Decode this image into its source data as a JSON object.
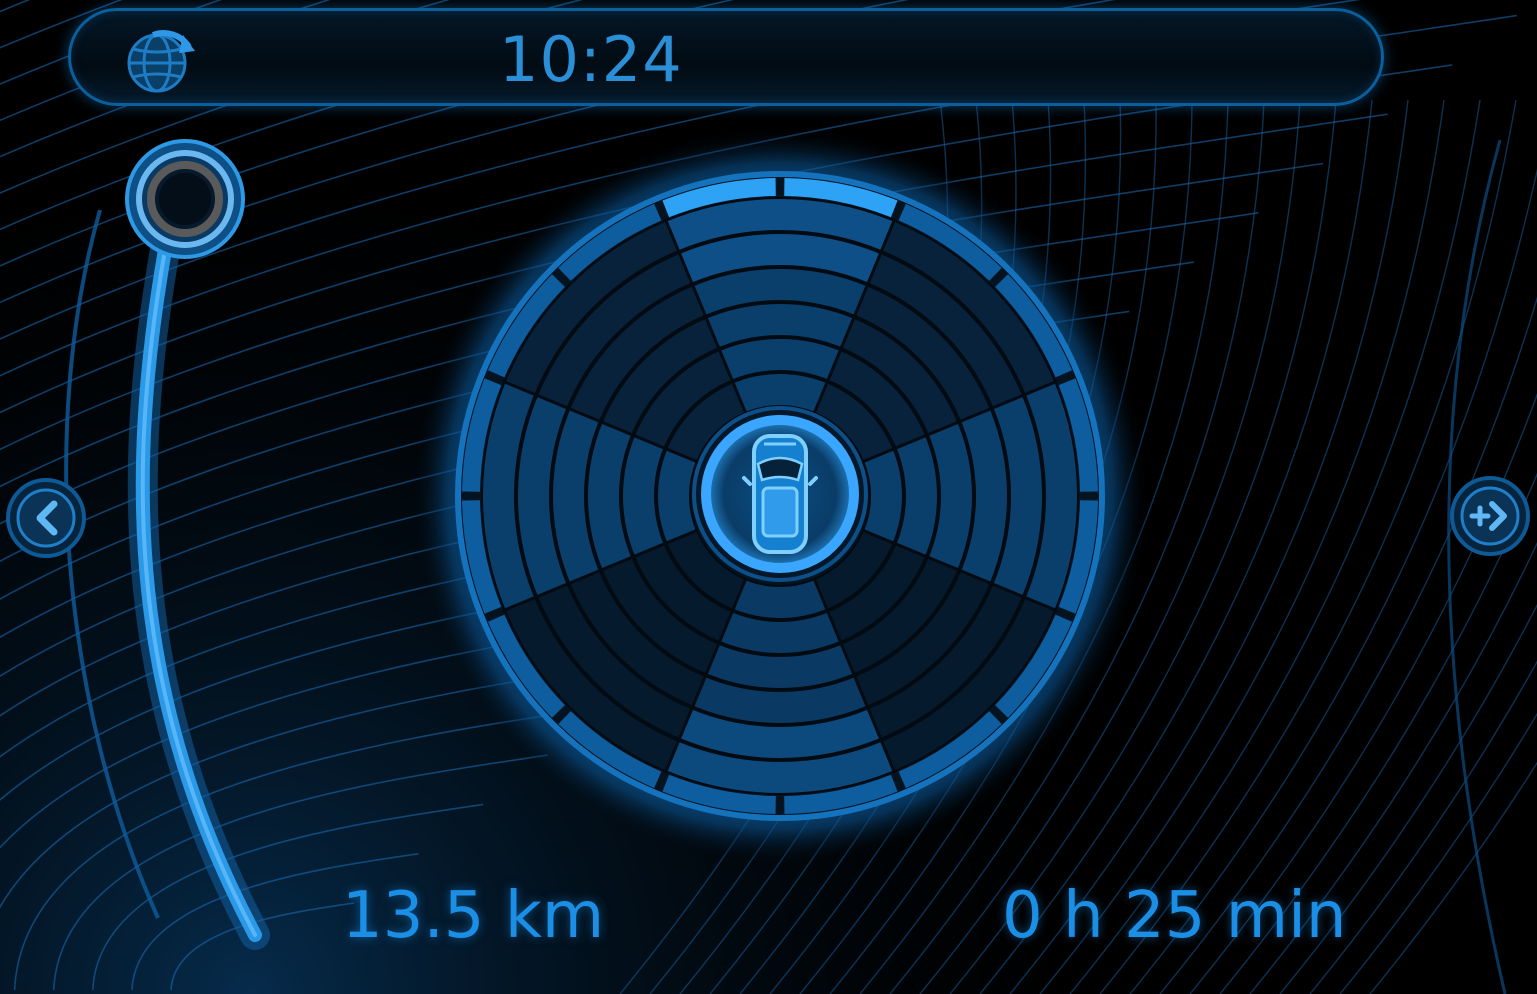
{
  "status_bar": {
    "time": "10:24",
    "icon": "globe-refresh-icon"
  },
  "range_slider": {
    "knob_icon": "circle-knob-icon",
    "level": 1.0
  },
  "navigation": {
    "prev_icon": "chevron-left-icon",
    "next_icon": "plus-chevron-right-icon"
  },
  "radar": {
    "center_icon": "car-topdown-icon",
    "rings": 6,
    "sectors": 8
  },
  "trip": {
    "distance": "13.5 km",
    "duration": "0 h 25 min"
  },
  "colors": {
    "accent": "#1b8fe6",
    "accent_bright": "#3aa6ff",
    "background": "#000000"
  }
}
